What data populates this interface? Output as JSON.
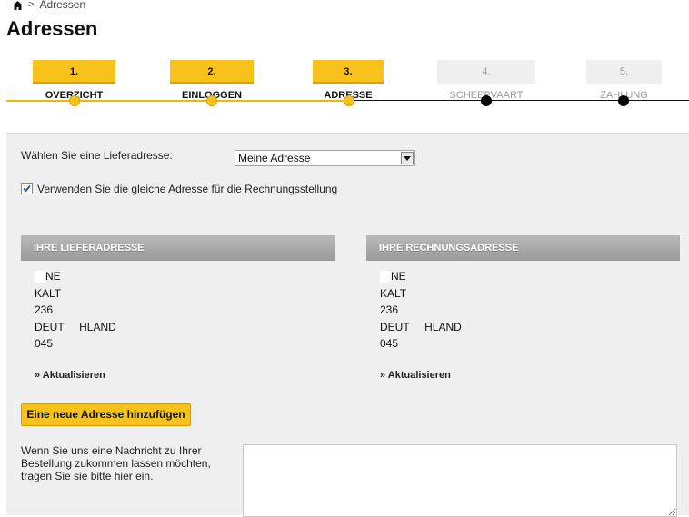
{
  "breadcrumb": {
    "current": "Adressen"
  },
  "page": {
    "title": "Adressen"
  },
  "steps": [
    {
      "label": "1. OVERZICHT",
      "state": "active"
    },
    {
      "label": "2. EINLOGGEN",
      "state": "active"
    },
    {
      "label": "3. ADRESSE",
      "state": "active"
    },
    {
      "label": "4. SCHEEPVAART",
      "state": "inactive"
    },
    {
      "label": "5. ZAHLUNG",
      "state": "inactive"
    }
  ],
  "delivery": {
    "select_label": "Wählen Sie eine Lieferadresse:",
    "selected_value": "Meine Adresse",
    "same_address_label": "Verwenden Sie die gleiche Adresse für die Rechnungsstellung",
    "same_address_checked": true
  },
  "shipping_address": {
    "header": "IHRE LIEFERADRESSE",
    "lines": [
      "NE",
      "KALT",
      "236",
      "DEUT     HLAND",
      "045"
    ],
    "update_link": "» Aktualisieren"
  },
  "billing_address": {
    "header": "IHRE RECHNUNGSADRESSE",
    "lines": [
      "NE",
      "KALT",
      "236",
      "DEUT     HLAND",
      "045"
    ],
    "update_link": "» Aktualisieren"
  },
  "add_address_button": "Eine neue Adresse hinzufügen",
  "note": {
    "label": "Wenn Sie uns eine Nachricht zu Ihrer Bestellung zukommen lassen möchten, tragen Sie sie bitte hier ein.",
    "value": ""
  },
  "colors": {
    "accent": "#f6c21b",
    "inactive_step": "#efefef",
    "panel": "#efefef",
    "header_gray": "#a8a8a8"
  }
}
